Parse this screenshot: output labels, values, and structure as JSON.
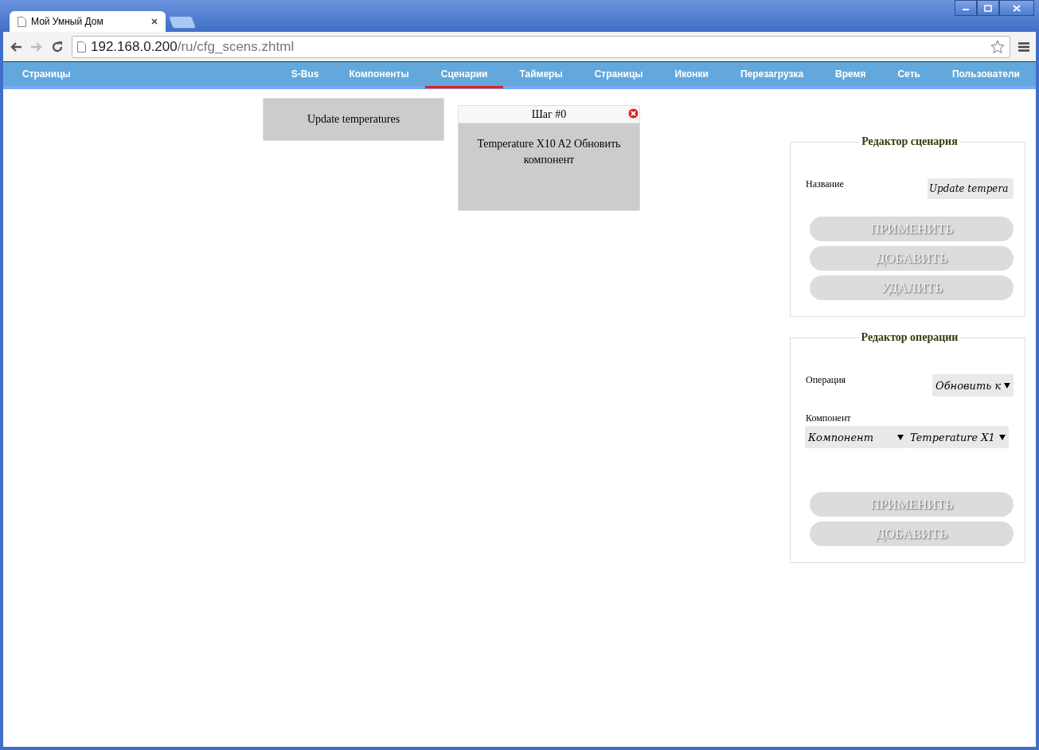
{
  "browser": {
    "tab_title": "Мой Умный Дом",
    "url_host": "192.168.0.200",
    "url_path": "/ru/cfg_scens.zhtml"
  },
  "nav": {
    "brand": "Страницы",
    "items": [
      {
        "label": "S-Bus",
        "selected": false
      },
      {
        "label": "Компоненты",
        "selected": false
      },
      {
        "label": "Сценарии",
        "selected": true
      },
      {
        "label": "Таймеры",
        "selected": false
      },
      {
        "label": "Страницы",
        "selected": false
      },
      {
        "label": "Иконки",
        "selected": false
      },
      {
        "label": "Перезагрузка",
        "selected": false
      },
      {
        "label": "Время",
        "selected": false
      },
      {
        "label": "Сеть",
        "selected": false
      },
      {
        "label": "Пользователи",
        "selected": false
      }
    ]
  },
  "scenarios": [
    {
      "name": "Update temperatures"
    }
  ],
  "steps": [
    {
      "title": "Шаг #0",
      "body": "Temperature X10 A2 Обновить компонент"
    }
  ],
  "scenario_editor": {
    "legend": "Редактор сценария",
    "name_label": "Название",
    "name_value": "Update tempera",
    "buttons": [
      "ПРИМЕНИТЬ",
      "ДОБАВИТЬ",
      "УДАЛИТЬ"
    ]
  },
  "operation_editor": {
    "legend": "Редактор операции",
    "operation_label": "Операция",
    "operation_value": "Обновить к",
    "component_label": "Компонент",
    "component_type": "Компонент",
    "component_value": "Temperature X1",
    "buttons": [
      "ПРИМЕНИТЬ",
      "ДОБАВИТЬ"
    ]
  }
}
